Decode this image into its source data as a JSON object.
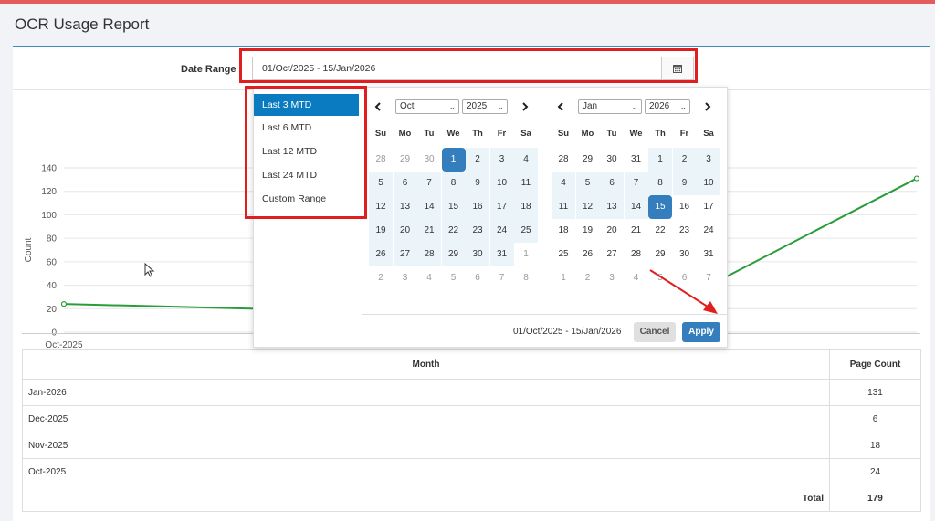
{
  "page": {
    "title": "OCR Usage Report"
  },
  "filter": {
    "label": "Date Range",
    "value": "01/Oct/2025 - 15/Jan/2026",
    "calendar_icon": "calendar-icon"
  },
  "picker": {
    "ranges": [
      "Last 3 MTD",
      "Last 6 MTD",
      "Last 12 MTD",
      "Last 24 MTD",
      "Custom Range"
    ],
    "active_range": "Last 3 MTD",
    "weekdays": [
      "Su",
      "Mo",
      "Tu",
      "We",
      "Th",
      "Fr",
      "Sa"
    ],
    "left": {
      "month": "Oct",
      "year": "2025",
      "weeks": [
        [
          "28",
          "29",
          "30",
          "1",
          "2",
          "3",
          "4"
        ],
        [
          "5",
          "6",
          "7",
          "8",
          "9",
          "10",
          "11"
        ],
        [
          "12",
          "13",
          "14",
          "15",
          "16",
          "17",
          "18"
        ],
        [
          "19",
          "20",
          "21",
          "22",
          "23",
          "24",
          "25"
        ],
        [
          "26",
          "27",
          "28",
          "29",
          "30",
          "31",
          "1"
        ],
        [
          "2",
          "3",
          "4",
          "5",
          "6",
          "7",
          "8"
        ]
      ]
    },
    "right": {
      "month": "Jan",
      "year": "2026",
      "weeks": [
        [
          "28",
          "29",
          "30",
          "31",
          "1",
          "2",
          "3"
        ],
        [
          "4",
          "5",
          "6",
          "7",
          "8",
          "9",
          "10"
        ],
        [
          "11",
          "12",
          "13",
          "14",
          "15",
          "16",
          "17"
        ],
        [
          "18",
          "19",
          "20",
          "21",
          "22",
          "23",
          "24"
        ],
        [
          "25",
          "26",
          "27",
          "28",
          "29",
          "30",
          "31"
        ],
        [
          "1",
          "2",
          "3",
          "4",
          "5",
          "6",
          "7"
        ]
      ]
    },
    "selected_text": "01/Oct/2025 - 15/Jan/2026",
    "cancel_label": "Cancel",
    "apply_label": "Apply",
    "prev_icon": "chevron-left-icon",
    "next_icon": "chevron-right-icon",
    "colors": {
      "accent": "#357ebd",
      "range_bg": "#ebf4f8",
      "annotation": "#e01e1e"
    }
  },
  "chart_data": {
    "type": "line",
    "ylabel": "Count",
    "yticks": [
      "0",
      "20",
      "40",
      "60",
      "80",
      "100",
      "120",
      "140"
    ],
    "ylim": [
      0,
      140
    ],
    "x_visible_label": "Oct-2025",
    "categories": [
      "Oct-2025",
      "Nov-2025",
      "Dec-2025",
      "Jan-2026"
    ],
    "values": [
      24,
      18,
      6,
      131
    ],
    "line_color": "#2a9d3a",
    "grid": true
  },
  "table": {
    "headers": [
      "Month",
      "Page Count"
    ],
    "rows": [
      [
        "Jan-2026",
        "131"
      ],
      [
        "Dec-2025",
        "6"
      ],
      [
        "Nov-2025",
        "18"
      ],
      [
        "Oct-2025",
        "24"
      ]
    ],
    "total_label": "Total",
    "total_value": "179"
  }
}
